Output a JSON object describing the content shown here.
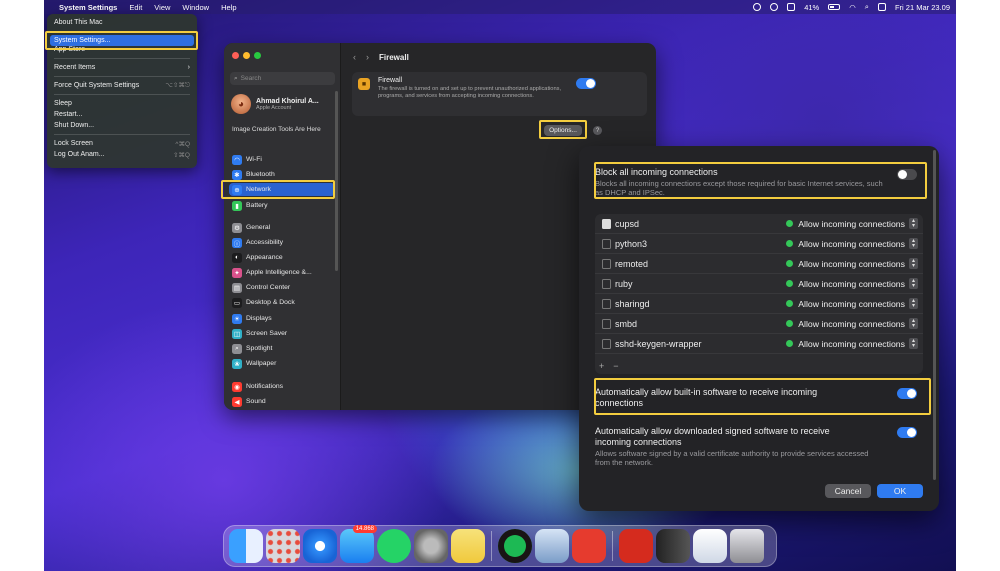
{
  "menubar": {
    "app": "System Settings",
    "menus": [
      "Edit",
      "View",
      "Window",
      "Help"
    ],
    "battery": "41%",
    "clock": "Fri 21 Mar 23.09"
  },
  "apple_menu": {
    "about": "About This Mac",
    "settings": "System Settings...",
    "app_store": "App Store",
    "recent": "Recent Items",
    "force_quit": "Force Quit System Settings",
    "force_quit_sc": "⌥⇧⌘⎋",
    "sleep": "Sleep",
    "restart": "Restart...",
    "shutdown": "Shut Down...",
    "lock": "Lock Screen",
    "lock_sc": "^⌘Q",
    "logout": "Log Out Anam...",
    "logout_sc": "⇧⌘Q"
  },
  "sidebar": {
    "search_placeholder": "Search",
    "account_name": "Ahmad Khoirul A...",
    "account_sub": "Apple Account",
    "promo": "Image Creation Tools Are Here",
    "items": [
      {
        "label": "Wi-Fi",
        "color": "#2f7bf0"
      },
      {
        "label": "Bluetooth",
        "color": "#2f7bf0"
      },
      {
        "label": "Network",
        "color": "#2f7bf0"
      },
      {
        "label": "Battery",
        "color": "#34c759"
      },
      {
        "label": "General",
        "color": "#8e8e93"
      },
      {
        "label": "Accessibility",
        "color": "#2f7bf0"
      },
      {
        "label": "Appearance",
        "color": "#1c1c1e"
      },
      {
        "label": "Apple Intelligence &...",
        "color": "#d9528b"
      },
      {
        "label": "Control Center",
        "color": "#8e8e93"
      },
      {
        "label": "Desktop & Dock",
        "color": "#1c1c1e"
      },
      {
        "label": "Displays",
        "color": "#2f7bf0"
      },
      {
        "label": "Screen Saver",
        "color": "#30b0c7"
      },
      {
        "label": "Spotlight",
        "color": "#8e8e93"
      },
      {
        "label": "Wallpaper",
        "color": "#30b0c7"
      },
      {
        "label": "Notifications",
        "color": "#ff3b30"
      },
      {
        "label": "Sound",
        "color": "#ff3b30"
      }
    ]
  },
  "firewall": {
    "nav_title": "Firewall",
    "title": "Firewall",
    "desc": "The firewall is turned on and set up to prevent unauthorized applications, programs, and services from accepting incoming connections.",
    "options_button": "Options...",
    "help": "?"
  },
  "options": {
    "block_title": "Block all incoming connections",
    "block_desc": "Blocks all incoming connections except those required for basic Internet services, such as DHCP and IPSec.",
    "apps": [
      {
        "name": "cupsd",
        "status": "Allow incoming connections"
      },
      {
        "name": "python3",
        "status": "Allow incoming connections"
      },
      {
        "name": "remoted",
        "status": "Allow incoming connections"
      },
      {
        "name": "ruby",
        "status": "Allow incoming connections"
      },
      {
        "name": "sharingd",
        "status": "Allow incoming connections"
      },
      {
        "name": "smbd",
        "status": "Allow incoming connections"
      },
      {
        "name": "sshd-keygen-wrapper",
        "status": "Allow incoming connections"
      }
    ],
    "plus": "+",
    "minus": "−",
    "builtin_title": "Automatically allow built-in software to receive incoming connections",
    "signed_title": "Automatically allow downloaded signed software to receive incoming connections",
    "signed_desc": "Allows software signed by a valid certificate authority to provide services accessed from the network.",
    "cancel": "Cancel",
    "ok": "OK"
  },
  "dock": {
    "mail_badge": "14.868"
  },
  "colors": {
    "highlight": "#f3cd3f",
    "accent": "#2f7bf0",
    "allow_dot": "#34c759"
  }
}
